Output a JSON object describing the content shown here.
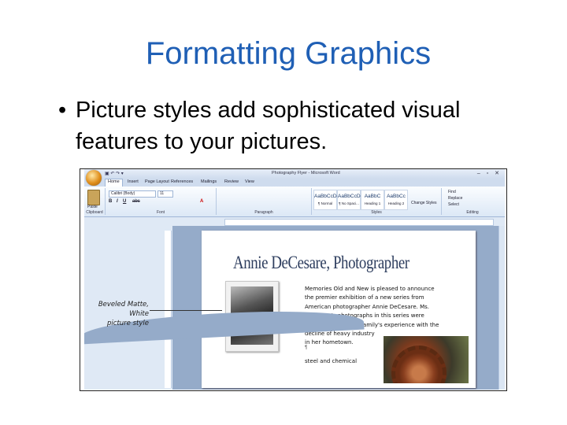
{
  "slide": {
    "title": "Formatting Graphics",
    "bullet_symbol": "•",
    "bullet_text": "Picture styles add sophisticated visual features to your pictures."
  },
  "callout": {
    "line1": "Beveled Matte, White",
    "line2": "picture style"
  },
  "word": {
    "window_title": "Photography Flyer - Microsoft Word",
    "window_controls": "– ▫ ✕",
    "qat_icons": "▣ ↶ ↷ ▾",
    "tabs": [
      "Home",
      "Insert",
      "Page Layout",
      "References",
      "Mailings",
      "Review",
      "View"
    ],
    "active_tab": "Home",
    "groups": {
      "clipboard": "Clipboard",
      "font": "Font",
      "paragraph": "Paragraph",
      "styles": "Styles",
      "editing": "Editing"
    },
    "paste_label": "Paste",
    "font_name": "Calibri (Body)",
    "font_size": "11",
    "format_buttons": [
      "B",
      "I",
      "U",
      "abc",
      "A"
    ],
    "style_gallery": [
      {
        "preview": "AaBbCcDc",
        "name": "¶ Normal"
      },
      {
        "preview": "AaBbCcDc",
        "name": "¶ No Spaci..."
      },
      {
        "preview": "AaBbC",
        "name": "Heading 1"
      },
      {
        "preview": "AaBbCc",
        "name": "Heading 2"
      }
    ],
    "change_styles": "Change Styles",
    "editing_items": [
      "Find",
      "Replace",
      "Select"
    ]
  },
  "document": {
    "heading": "Annie DeCesare, Photographer",
    "body_lines": [
      "Memories Old and New is pleased to announce",
      "the premier exhibition of a new series from",
      "American photographer Annie DeCesare. Ms.",
      "DeCesare's photographs in this series were",
      "inspired by her own family's experience with the",
      "decline of heavy industry",
      "in her hometown."
    ],
    "paragraph_mark": "¶",
    "last_line": "steel and chemical"
  }
}
